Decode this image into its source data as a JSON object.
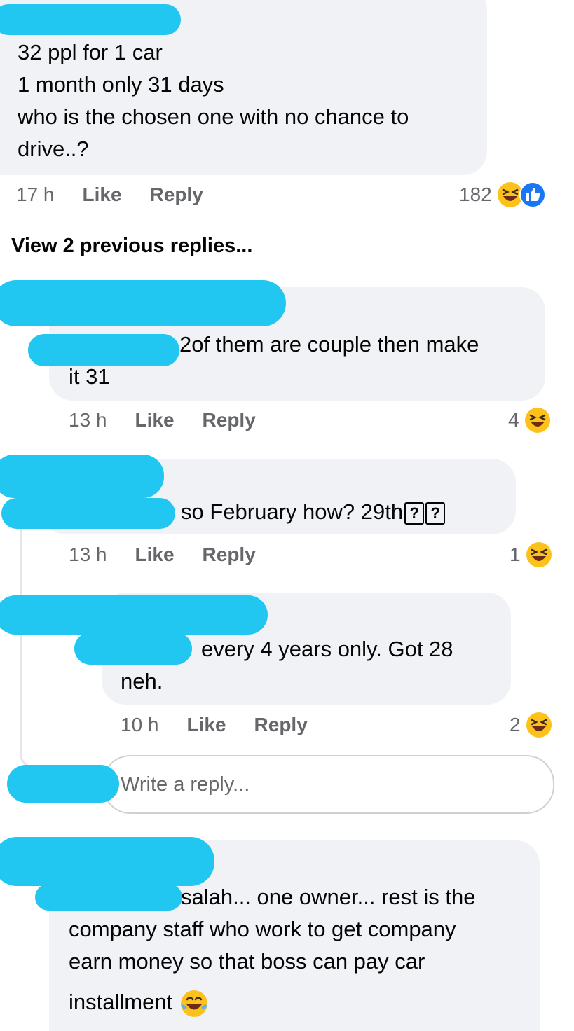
{
  "comments": [
    {
      "lines": [
        "32 ppl for 1 car",
        "1 month only 31 days",
        "who is the chosen one with no chance to",
        "drive..?"
      ],
      "time": "17 h",
      "like": "Like",
      "reply": "Reply",
      "reaction_count": "182",
      "reactions": [
        "laughing-emoji",
        "like-icon"
      ]
    },
    {
      "lines": [
        "2of them are couple then make",
        "it 31"
      ],
      "time": "13 h",
      "like": "Like",
      "reply": "Reply",
      "reaction_count": "4",
      "reactions": [
        "laughing-emoji"
      ]
    },
    {
      "text": "so February how?  29th",
      "unknown_glyph": "?",
      "time": "13 h",
      "like": "Like",
      "reply": "Reply",
      "reaction_count": "1",
      "reactions": [
        "laughing-emoji"
      ]
    },
    {
      "lines": [
        "every 4 years only. Got 28",
        "neh."
      ],
      "time": "10 h",
      "like": "Like",
      "reply": "Reply",
      "reaction_count": "2",
      "reactions": [
        "laughing-emoji"
      ]
    },
    {
      "lines": [
        "salah... one owner... rest is the",
        "company staff who work to get company",
        "earn money so that boss can pay car",
        "installment"
      ],
      "inline_emoji": "tears-of-joy-emoji"
    }
  ],
  "view_previous": "View 2 previous replies...",
  "reply_input": {
    "placeholder": "Write a reply..."
  },
  "colors": {
    "bubble": "#f0f2f5",
    "meta_text": "#65676b",
    "redaction": "#21c7f0",
    "like_blue": "#1877f2",
    "emoji_yellow": "#fcc21b"
  }
}
